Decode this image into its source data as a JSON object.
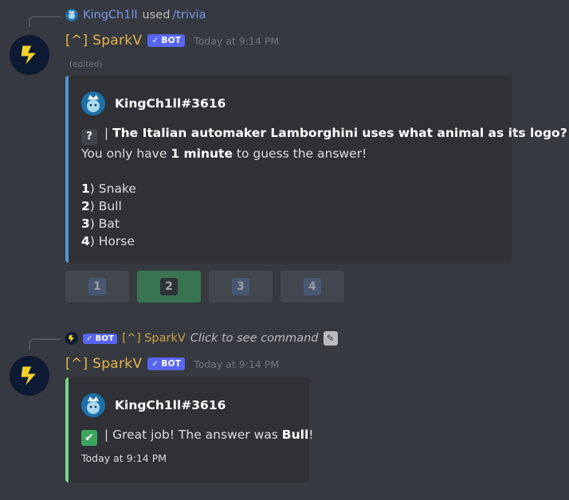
{
  "message1": {
    "reply": {
      "user": "KingCh1ll",
      "used": "used",
      "command": "/trivia"
    },
    "author": "[^] SparkV",
    "bot_tag": "BOT",
    "timestamp": "Today at 9:14 PM",
    "edited": "(edited)",
    "embed": {
      "accent_color": "#5296d5",
      "author_name": "KingCh1ll#3616",
      "question_emoji": "?",
      "question_sep": " | ",
      "question": "The Italian automaker Lamborghini uses what animal as its logo?",
      "time_prefix": "You only have ",
      "time_bold": "1 minute",
      "time_suffix": " to guess the answer!",
      "options": [
        {
          "num": "1",
          "text": "Snake"
        },
        {
          "num": "2",
          "text": "Bull"
        },
        {
          "num": "3",
          "text": "Bat"
        },
        {
          "num": "4",
          "text": "Horse"
        }
      ]
    },
    "buttons": [
      {
        "label": "1",
        "style": "secondary"
      },
      {
        "label": "2",
        "style": "success"
      },
      {
        "label": "3",
        "style": "secondary"
      },
      {
        "label": "4",
        "style": "secondary"
      }
    ]
  },
  "message2": {
    "reply": {
      "bot_tag": "BOT",
      "author": "[^] SparkV",
      "click_text": "Click to see command"
    },
    "author": "[^] SparkV",
    "bot_tag": "BOT",
    "timestamp": "Today at 9:14 PM",
    "embed": {
      "accent_color": "#77d48b",
      "author_name": "KingCh1ll#3616",
      "result_sep": " | ",
      "result_prefix": "Great job! The answer was ",
      "result_bold": "Bull",
      "result_suffix": "!",
      "footer": "Today at 9:14 PM"
    }
  },
  "colors": {
    "background": "#36393f",
    "embed_bg": "#2f3136",
    "author": "#e6b44a",
    "bot_tag": "#5865f2",
    "reply_link": "#7b96e8"
  }
}
